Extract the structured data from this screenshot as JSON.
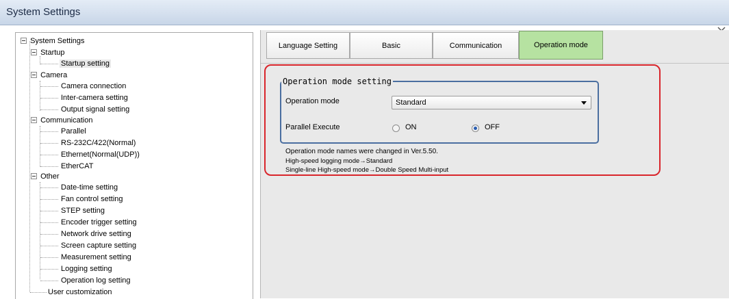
{
  "window": {
    "title": "System Settings"
  },
  "tree": {
    "root": "System Settings",
    "startup": {
      "label": "Startup",
      "items": [
        "Startup setting"
      ]
    },
    "camera": {
      "label": "Camera",
      "items": [
        "Camera connection",
        "Inter-camera setting",
        "Output signal setting"
      ]
    },
    "communication": {
      "label": "Communication",
      "items": [
        "Parallel",
        "RS-232C/422(Normal)",
        "Ethernet(Normal(UDP))",
        "EtherCAT"
      ]
    },
    "other": {
      "label": "Other",
      "items": [
        "Date-time setting",
        "Fan control setting",
        "STEP setting",
        "Encoder trigger setting",
        "Network drive setting",
        "Screen capture setting",
        "Measurement setting",
        "Logging setting",
        "Operation log setting"
      ]
    },
    "user_customization": "User customization",
    "selected": "Startup setting"
  },
  "tabs": [
    "Language Setting",
    "Basic",
    "Communication",
    "Operation mode"
  ],
  "active_tab": "Operation mode",
  "operation_mode": {
    "group_title": "Operation mode setting",
    "mode_label": "Operation mode",
    "mode_value": "Standard",
    "parallel_label": "Parallel Execute",
    "on_label": "ON",
    "off_label": "OFF",
    "parallel_selected": "OFF"
  },
  "notes": [
    "Operation mode names were changed in Ver.5.50.",
    " High-speed logging mode→Standard",
    " Single-line High-speed mode→Double Speed Multi-input"
  ],
  "colors": {
    "active_tab": "#b6e2a1",
    "group_border": "#4a6ea0",
    "highlight": "#d9252b"
  }
}
